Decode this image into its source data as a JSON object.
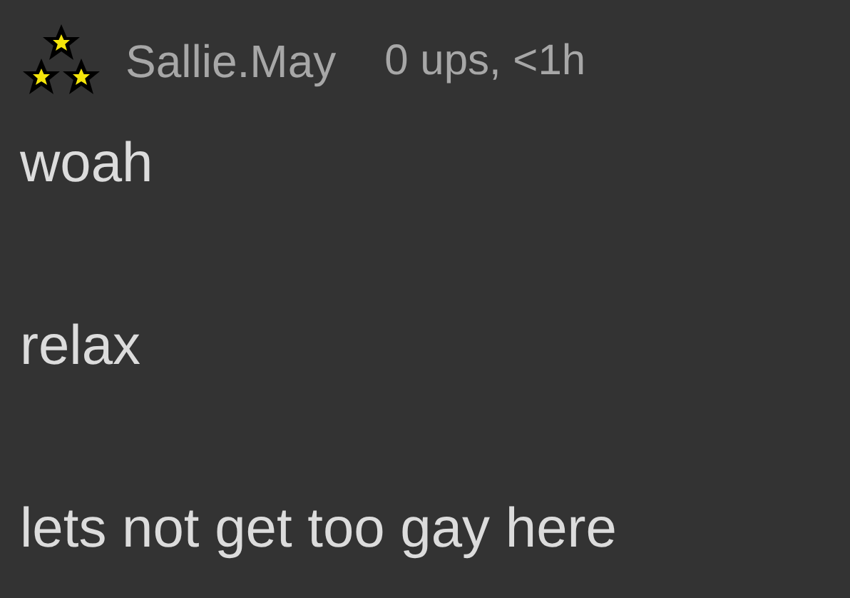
{
  "comment": {
    "username": "Sallie.May",
    "meta": "0 ups, <1h",
    "paragraphs": [
      "woah",
      "relax",
      "lets not get too gay here"
    ]
  }
}
